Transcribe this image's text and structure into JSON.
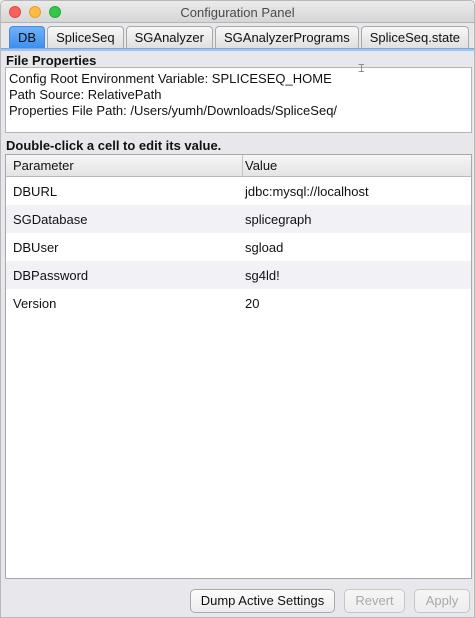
{
  "window": {
    "title": "Configuration Panel"
  },
  "tabs": [
    {
      "label": "DB",
      "active": true
    },
    {
      "label": "SpliceSeq",
      "active": false
    },
    {
      "label": "SGAnalyzer",
      "active": false
    },
    {
      "label": "SGAnalyzerPrograms",
      "active": false
    },
    {
      "label": "SpliceSeq.state",
      "active": false
    }
  ],
  "file_properties": {
    "heading": "File Properties",
    "lines": [
      "Config Root Environment Variable: SPLICESEQ_HOME",
      "Path Source: RelativePath",
      "Properties File Path: /Users/yumh/Downloads/SpliceSeq/"
    ]
  },
  "table": {
    "instruction": "Double-click a cell to edit its value.",
    "columns": [
      "Parameter",
      "Value"
    ],
    "rows": [
      {
        "parameter": "DBURL",
        "value": "jdbc:mysql://localhost"
      },
      {
        "parameter": "SGDatabase",
        "value": "splicegraph"
      },
      {
        "parameter": "DBUser",
        "value": "sgload"
      },
      {
        "parameter": "DBPassword",
        "value": "sg4ld!"
      },
      {
        "parameter": "Version",
        "value": "20"
      }
    ]
  },
  "buttons": {
    "dump": {
      "label": "Dump Active Settings",
      "enabled": true
    },
    "revert": {
      "label": "Revert",
      "enabled": false
    },
    "apply": {
      "label": "Apply",
      "enabled": false
    }
  },
  "colors": {
    "active_tab": "#3d8ff0",
    "alt_row": "#f2f2f6",
    "close": "#fc605c",
    "minimize": "#fdbc40",
    "maximize": "#34c84a"
  }
}
